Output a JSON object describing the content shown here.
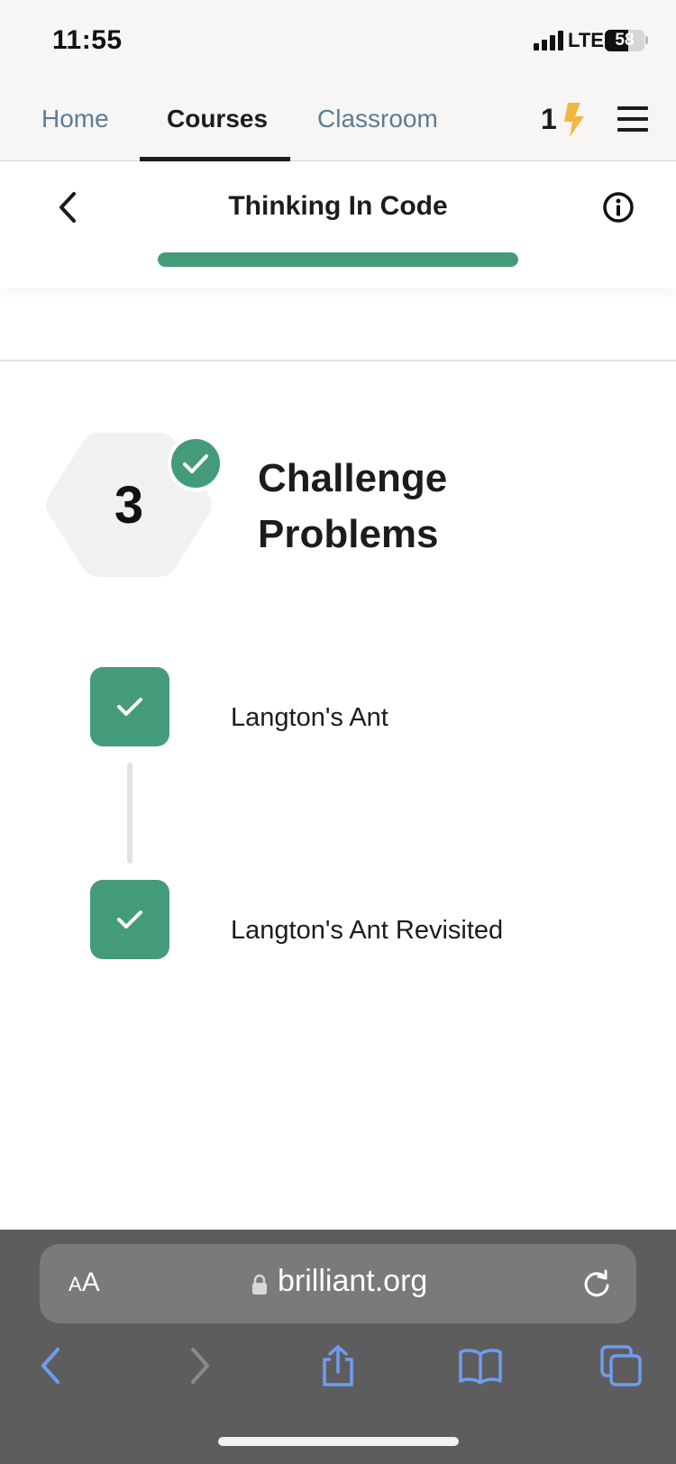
{
  "status_bar": {
    "time": "11:55",
    "network": "LTE",
    "battery": "58"
  },
  "nav": {
    "tabs": [
      {
        "label": "Home"
      },
      {
        "label": "Courses"
      },
      {
        "label": "Classroom"
      }
    ],
    "active_tab": "Courses",
    "streak_count": "1"
  },
  "course": {
    "title": "Thinking In Code",
    "progress": 1.0
  },
  "chapter": {
    "number": "3",
    "title": "Challenge Problems",
    "completed": true
  },
  "lessons": [
    {
      "title": "Langton's Ant",
      "completed": true
    },
    {
      "title": "Langton's Ant Revisited",
      "completed": true
    }
  ],
  "browser": {
    "text_size_label": "AA",
    "url": "brilliant.org"
  },
  "colors": {
    "accent": "#449b7a",
    "streak": "#f2b641",
    "toolbar_icon": "#6f9cf2"
  },
  "icons": [
    "back-chevron-icon",
    "info-icon",
    "lightning-bolt-icon",
    "hamburger-menu-icon",
    "checkmark-icon",
    "lock-icon",
    "reload-icon",
    "share-icon",
    "bookmarks-icon",
    "tabs-icon"
  ]
}
